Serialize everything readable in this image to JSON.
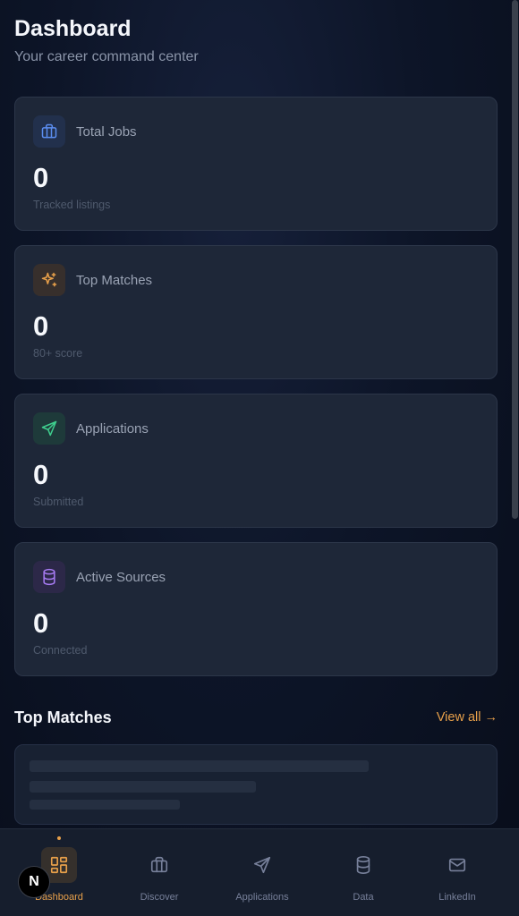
{
  "header": {
    "title": "Dashboard",
    "subtitle": "Your career command center"
  },
  "stats": [
    {
      "label": "Total Jobs",
      "value": "0",
      "sub": "Tracked listings",
      "icon": "briefcase-icon",
      "color": "#5b8def"
    },
    {
      "label": "Top Matches",
      "value": "0",
      "sub": "80+ score",
      "icon": "sparkles-icon",
      "color": "#e8a04a"
    },
    {
      "label": "Applications",
      "value": "0",
      "sub": "Submitted",
      "icon": "send-icon",
      "color": "#3fcf8e"
    },
    {
      "label": "Active Sources",
      "value": "0",
      "sub": "Connected",
      "icon": "database-icon",
      "color": "#a77bf3"
    }
  ],
  "top_matches": {
    "title": "Top Matches",
    "view_all": "View all →"
  },
  "nav": {
    "items": [
      {
        "label": "Dashboard",
        "icon": "dashboard-icon",
        "active": true
      },
      {
        "label": "Discover",
        "icon": "briefcase-icon"
      },
      {
        "label": "Applications",
        "icon": "send-icon"
      },
      {
        "label": "Data",
        "icon": "database-icon"
      },
      {
        "label": "LinkedIn",
        "icon": "mail-icon"
      }
    ]
  },
  "badge": {
    "letter": "N"
  },
  "colors": {
    "accent": "#e8a04a",
    "card_bg": "#1e2738",
    "background": "#0a1020"
  }
}
